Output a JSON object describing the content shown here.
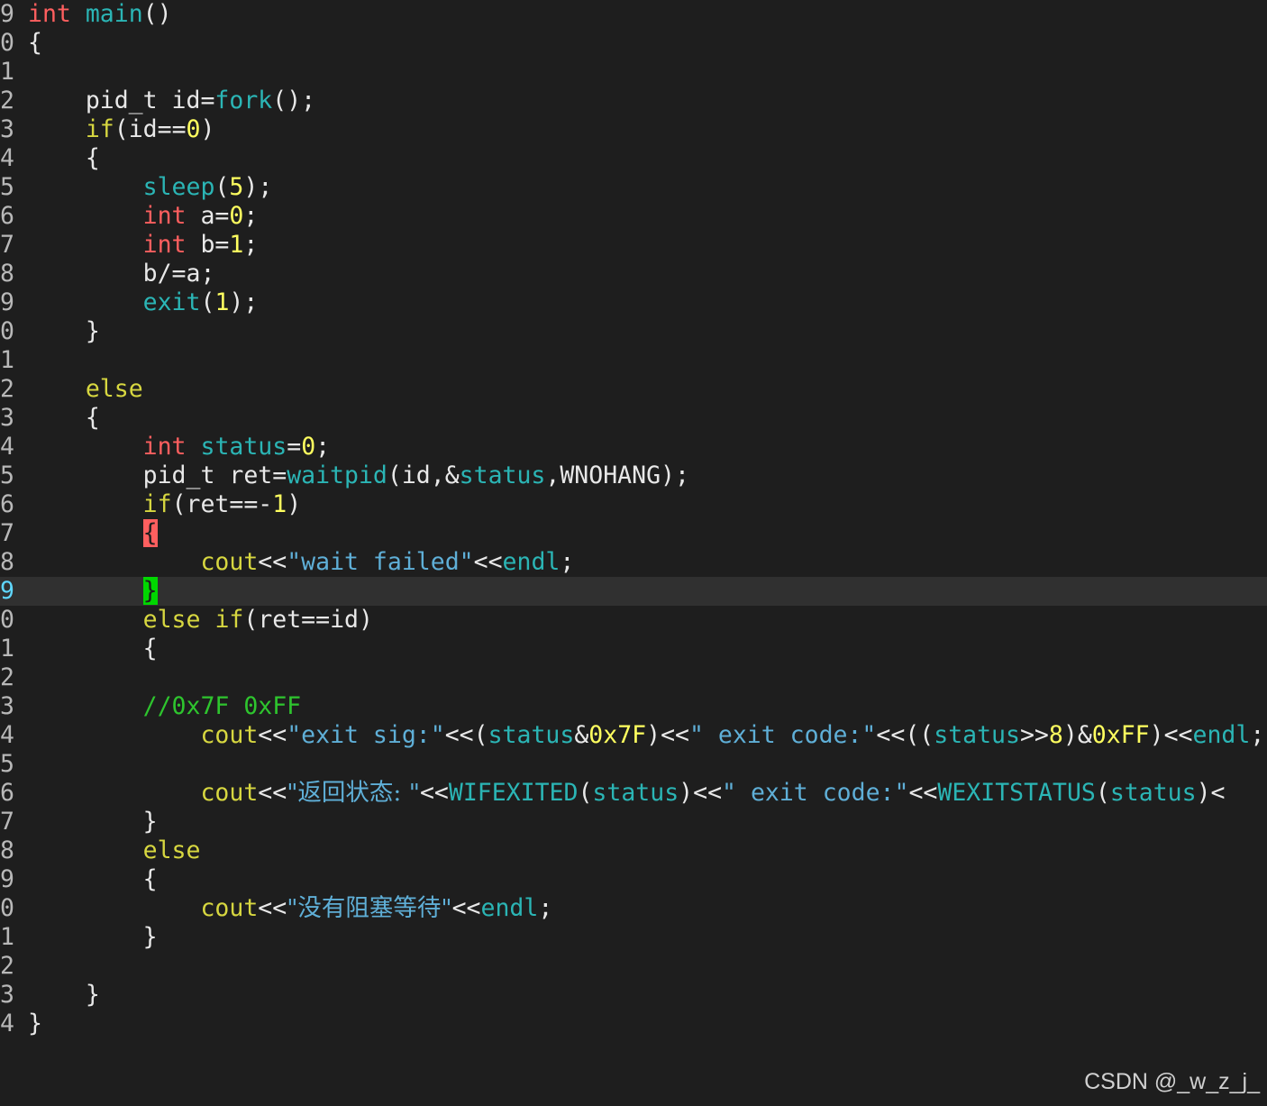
{
  "editor": {
    "current_line_index": 20,
    "lines": [
      {
        "num": "9",
        "tokens": [
          [
            "kw-type",
            "int"
          ],
          [
            "plain",
            " "
          ],
          [
            "fn",
            "main"
          ],
          [
            "plain",
            "()"
          ]
        ]
      },
      {
        "num": "0",
        "tokens": [
          [
            "plain",
            "{"
          ]
        ]
      },
      {
        "num": "1",
        "tokens": []
      },
      {
        "num": "2",
        "tokens": [
          [
            "plain",
            "    pid_t id="
          ],
          [
            "fn",
            "fork"
          ],
          [
            "plain",
            "();"
          ]
        ]
      },
      {
        "num": "3",
        "tokens": [
          [
            "plain",
            "    "
          ],
          [
            "kw",
            "if"
          ],
          [
            "plain",
            "(id=="
          ],
          [
            "num",
            "0"
          ],
          [
            "plain",
            ")"
          ]
        ]
      },
      {
        "num": "4",
        "tokens": [
          [
            "plain",
            "    {"
          ]
        ]
      },
      {
        "num": "5",
        "tokens": [
          [
            "plain",
            "        "
          ],
          [
            "fn",
            "sleep"
          ],
          [
            "plain",
            "("
          ],
          [
            "num",
            "5"
          ],
          [
            "plain",
            ");"
          ]
        ]
      },
      {
        "num": "6",
        "tokens": [
          [
            "plain",
            "        "
          ],
          [
            "kw-type",
            "int"
          ],
          [
            "plain",
            " a="
          ],
          [
            "num",
            "0"
          ],
          [
            "plain",
            ";"
          ]
        ]
      },
      {
        "num": "7",
        "tokens": [
          [
            "plain",
            "        "
          ],
          [
            "kw-type",
            "int"
          ],
          [
            "plain",
            " b="
          ],
          [
            "num",
            "1"
          ],
          [
            "plain",
            ";"
          ]
        ]
      },
      {
        "num": "8",
        "tokens": [
          [
            "plain",
            "        b/=a;"
          ]
        ]
      },
      {
        "num": "9",
        "tokens": [
          [
            "plain",
            "        "
          ],
          [
            "fn",
            "exit"
          ],
          [
            "plain",
            "("
          ],
          [
            "num",
            "1"
          ],
          [
            "plain",
            ");"
          ]
        ]
      },
      {
        "num": "0",
        "tokens": [
          [
            "plain",
            "    }"
          ]
        ]
      },
      {
        "num": "1",
        "tokens": []
      },
      {
        "num": "2",
        "tokens": [
          [
            "plain",
            "    "
          ],
          [
            "kw",
            "else"
          ]
        ]
      },
      {
        "num": "3",
        "tokens": [
          [
            "plain",
            "    {"
          ]
        ]
      },
      {
        "num": "4",
        "tokens": [
          [
            "plain",
            "        "
          ],
          [
            "kw-type",
            "int"
          ],
          [
            "plain",
            " "
          ],
          [
            "fn",
            "status"
          ],
          [
            "plain",
            "="
          ],
          [
            "num",
            "0"
          ],
          [
            "plain",
            ";"
          ]
        ]
      },
      {
        "num": "5",
        "tokens": [
          [
            "plain",
            "        pid_t ret="
          ],
          [
            "fn",
            "waitpid"
          ],
          [
            "plain",
            "(id,&"
          ],
          [
            "fn",
            "status"
          ],
          [
            "plain",
            ",WNOHANG);"
          ]
        ]
      },
      {
        "num": "6",
        "tokens": [
          [
            "plain",
            "        "
          ],
          [
            "kw",
            "if"
          ],
          [
            "plain",
            "(ret==-"
          ],
          [
            "num",
            "1"
          ],
          [
            "plain",
            ")"
          ]
        ]
      },
      {
        "num": "7",
        "tokens": [
          [
            "plain",
            "        "
          ],
          [
            "cursor-red",
            "{"
          ]
        ]
      },
      {
        "num": "8",
        "tokens": [
          [
            "plain",
            "            "
          ],
          [
            "kw",
            "cout"
          ],
          [
            "plain",
            "<<"
          ],
          [
            "str",
            "\"wait failed\""
          ],
          [
            "plain",
            "<<"
          ],
          [
            "fn",
            "endl"
          ],
          [
            "plain",
            ";"
          ]
        ]
      },
      {
        "num": "9",
        "tokens": [
          [
            "plain",
            "        "
          ],
          [
            "cursor-green",
            "}"
          ]
        ]
      },
      {
        "num": "0",
        "tokens": [
          [
            "plain",
            "        "
          ],
          [
            "kw",
            "else"
          ],
          [
            "plain",
            " "
          ],
          [
            "kw",
            "if"
          ],
          [
            "plain",
            "(ret==id)"
          ]
        ]
      },
      {
        "num": "1",
        "tokens": [
          [
            "plain",
            "        {"
          ]
        ]
      },
      {
        "num": "2",
        "tokens": []
      },
      {
        "num": "3",
        "tokens": [
          [
            "plain",
            "        "
          ],
          [
            "com",
            "//0x7F 0xFF"
          ]
        ]
      },
      {
        "num": "4",
        "tokens": [
          [
            "plain",
            "            "
          ],
          [
            "kw",
            "cout"
          ],
          [
            "plain",
            "<<"
          ],
          [
            "str",
            "\"exit sig:\""
          ],
          [
            "plain",
            "<<("
          ],
          [
            "fn",
            "status"
          ],
          [
            "plain",
            "&"
          ],
          [
            "num",
            "0x7F"
          ],
          [
            "plain",
            ")<<"
          ],
          [
            "str",
            "\" exit code:\""
          ],
          [
            "plain",
            "<<(("
          ],
          [
            "fn",
            "status"
          ],
          [
            "plain",
            ">>"
          ],
          [
            "num",
            "8"
          ],
          [
            "plain",
            ")&"
          ],
          [
            "num",
            "0xFF"
          ],
          [
            "plain",
            ")<<"
          ],
          [
            "fn",
            "endl"
          ],
          [
            "plain",
            ";"
          ]
        ]
      },
      {
        "num": "5",
        "tokens": []
      },
      {
        "num": "6",
        "tokens": [
          [
            "plain",
            "            "
          ],
          [
            "kw",
            "cout"
          ],
          [
            "plain",
            "<<"
          ],
          [
            "str",
            "\"返回状态: \""
          ],
          [
            "plain",
            "<<"
          ],
          [
            "fn",
            "WIFEXITED"
          ],
          [
            "plain",
            "("
          ],
          [
            "fn",
            "status"
          ],
          [
            "plain",
            ")<<"
          ],
          [
            "str",
            "\" exit code:\""
          ],
          [
            "plain",
            "<<"
          ],
          [
            "fn",
            "WEXITSTATUS"
          ],
          [
            "plain",
            "("
          ],
          [
            "fn",
            "status"
          ],
          [
            "plain",
            ")<"
          ]
        ]
      },
      {
        "num": "7",
        "tokens": [
          [
            "plain",
            "        }"
          ]
        ]
      },
      {
        "num": "8",
        "tokens": [
          [
            "plain",
            "        "
          ],
          [
            "kw",
            "else"
          ]
        ]
      },
      {
        "num": "9",
        "tokens": [
          [
            "plain",
            "        {"
          ]
        ]
      },
      {
        "num": "0",
        "tokens": [
          [
            "plain",
            "            "
          ],
          [
            "kw",
            "cout"
          ],
          [
            "plain",
            "<<"
          ],
          [
            "str",
            "\"没有阻塞等待\""
          ],
          [
            "plain",
            "<<"
          ],
          [
            "fn",
            "endl"
          ],
          [
            "plain",
            ";"
          ]
        ]
      },
      {
        "num": "1",
        "tokens": [
          [
            "plain",
            "        }"
          ]
        ]
      },
      {
        "num": "2",
        "tokens": []
      },
      {
        "num": "3",
        "tokens": [
          [
            "plain",
            "    }"
          ]
        ]
      },
      {
        "num": "4",
        "tokens": [
          [
            "plain",
            "}"
          ]
        ]
      }
    ]
  },
  "watermark": "CSDN @_w_z_j_",
  "colors": {
    "background": "#1e1e1e",
    "current_line": "#303030",
    "type_keyword": "#ff5f5f",
    "statement_keyword": "#d7d740",
    "identifier": "#2bb5b5",
    "number": "#ffff5f",
    "string": "#5fafd7",
    "comment": "#2ec52e",
    "cursor_match_open": "#ff5f5f",
    "cursor_match_close": "#00d700"
  }
}
